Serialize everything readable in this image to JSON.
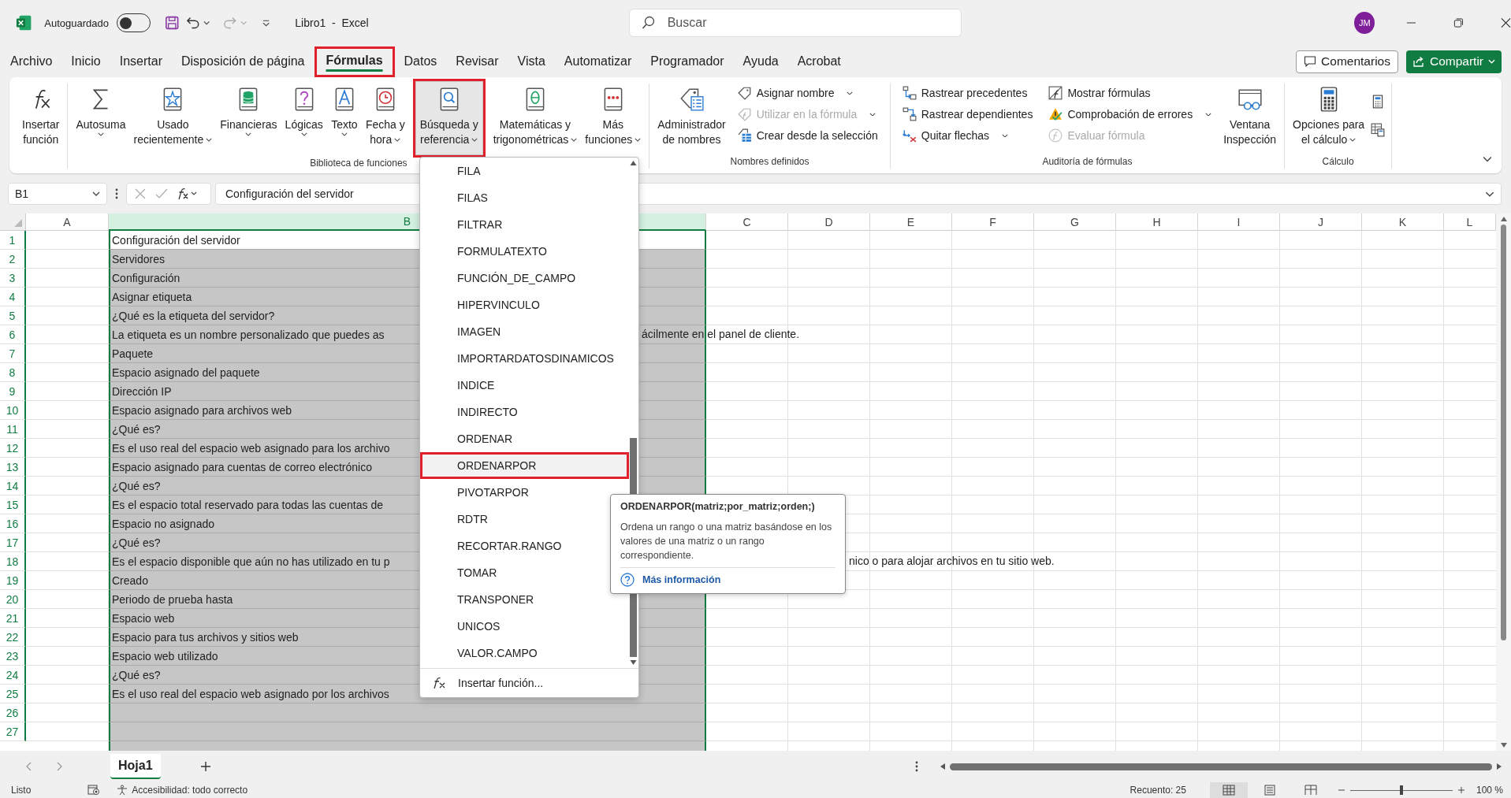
{
  "title_bar": {
    "autosave_label": "Autoguardado",
    "autosave_on": false,
    "title": "Libro1  -  Excel",
    "search_placeholder": "Buscar",
    "avatar": "JM"
  },
  "menu_tabs": [
    {
      "label": "Archivo",
      "selected": false,
      "highlighted": false
    },
    {
      "label": "Inicio",
      "selected": false,
      "highlighted": false
    },
    {
      "label": "Insertar",
      "selected": false,
      "highlighted": false
    },
    {
      "label": "Disposición de página",
      "selected": false,
      "highlighted": false
    },
    {
      "label": "Fórmulas",
      "selected": true,
      "highlighted": true
    },
    {
      "label": "Datos",
      "selected": false,
      "highlighted": false
    },
    {
      "label": "Revisar",
      "selected": false,
      "highlighted": false
    },
    {
      "label": "Vista",
      "selected": false,
      "highlighted": false
    },
    {
      "label": "Automatizar",
      "selected": false,
      "highlighted": false
    },
    {
      "label": "Programador",
      "selected": false,
      "highlighted": false
    },
    {
      "label": "Ayuda",
      "selected": false,
      "highlighted": false
    },
    {
      "label": "Acrobat",
      "selected": false,
      "highlighted": false
    }
  ],
  "comments_button": "Comentarios",
  "share_button": "Compartir",
  "ribbon": {
    "groups": [
      {
        "parts": [
          {
            "kind": "big",
            "lines": [
              "Insertar",
              "función"
            ],
            "dropdown": false,
            "selected": false,
            "highlighted": false
          }
        ]
      },
      {
        "label": "Biblioteca de funciones",
        "parts": [
          {
            "kind": "big",
            "lines": [
              "Autosuma"
            ],
            "dropdown": true,
            "selected": false,
            "highlighted": false
          },
          {
            "kind": "big",
            "lines": [
              "Usado",
              "recientemente"
            ],
            "dropdown": true,
            "selected": false,
            "highlighted": false
          },
          {
            "kind": "big",
            "lines": [
              "Financieras"
            ],
            "dropdown": true,
            "selected": false,
            "highlighted": false
          },
          {
            "kind": "big",
            "lines": [
              "Lógicas"
            ],
            "dropdown": true,
            "selected": false,
            "highlighted": false
          },
          {
            "kind": "big",
            "lines": [
              "Texto"
            ],
            "dropdown": true,
            "selected": false,
            "highlighted": false
          },
          {
            "kind": "big",
            "lines": [
              "Fecha y",
              "hora"
            ],
            "dropdown": true,
            "selected": false,
            "highlighted": false
          },
          {
            "kind": "big",
            "lines": [
              "Búsqueda y",
              "referencia"
            ],
            "dropdown": true,
            "selected": true,
            "highlighted": true
          },
          {
            "kind": "big",
            "lines": [
              "Matemáticas y",
              "trigonométricas"
            ],
            "dropdown": true,
            "selected": false,
            "highlighted": false
          },
          {
            "kind": "big",
            "lines": [
              "Más",
              "funciones"
            ],
            "dropdown": true,
            "selected": false,
            "highlighted": false
          }
        ]
      },
      {
        "label": "Nombres definidos",
        "parts": [
          {
            "kind": "big",
            "lines": [
              "Administrador",
              "de nombres"
            ],
            "dropdown": false,
            "selected": false,
            "highlighted": false
          },
          {
            "kind": "column",
            "items": [
              {
                "label": "Asignar nombre",
                "dropdown": true,
                "disabled": false
              },
              {
                "label": "Utilizar en la fórmula",
                "dropdown": true,
                "disabled": true
              },
              {
                "label": "Crear desde la selección",
                "dropdown": false,
                "disabled": false
              }
            ]
          }
        ]
      },
      {
        "label": "Auditoría de fórmulas",
        "parts": [
          {
            "kind": "column",
            "items": [
              {
                "label": "Rastrear precedentes",
                "dropdown": false,
                "disabled": false
              },
              {
                "label": "Rastrear dependientes",
                "dropdown": false,
                "disabled": false
              },
              {
                "label": "Quitar flechas",
                "dropdown": true,
                "disabled": false
              }
            ]
          },
          {
            "kind": "column",
            "items": [
              {
                "label": "Mostrar fórmulas",
                "dropdown": false,
                "disabled": false
              },
              {
                "label": "Comprobación de errores",
                "dropdown": true,
                "disabled": false
              },
              {
                "label": "Evaluar fórmula",
                "dropdown": false,
                "disabled": true
              }
            ]
          },
          {
            "kind": "big",
            "lines": [
              "Ventana",
              "Inspección"
            ],
            "dropdown": false,
            "selected": false,
            "highlighted": false
          }
        ]
      },
      {
        "label": "Cálculo",
        "parts": [
          {
            "kind": "big",
            "lines": [
              "Opciones para",
              "el cálculo"
            ],
            "dropdown": true,
            "selected": false,
            "highlighted": false
          },
          {
            "kind": "icons"
          }
        ]
      }
    ]
  },
  "formula_bar": {
    "name_box": "B1",
    "formula": "Configuración del servidor"
  },
  "columns": [
    {
      "label": "A",
      "selected": false
    },
    {
      "label": "B",
      "selected": true
    },
    {
      "label": "C",
      "selected": false
    },
    {
      "label": "D",
      "selected": false
    },
    {
      "label": "E",
      "selected": false
    },
    {
      "label": "F",
      "selected": false
    },
    {
      "label": "G",
      "selected": false
    },
    {
      "label": "H",
      "selected": false
    },
    {
      "label": "I",
      "selected": false
    },
    {
      "label": "J",
      "selected": false
    },
    {
      "label": "K",
      "selected": false
    },
    {
      "label": "L",
      "selected": false
    }
  ],
  "rows": [
    {
      "number": "1",
      "selected": true,
      "active": true,
      "text": "Configuración del servidor"
    },
    {
      "number": "2",
      "selected": true,
      "active": false,
      "text": "Servidores"
    },
    {
      "number": "3",
      "selected": true,
      "active": false,
      "text": "Configuración"
    },
    {
      "number": "4",
      "selected": true,
      "active": false,
      "text": "Asignar etiqueta"
    },
    {
      "number": "5",
      "selected": true,
      "active": false,
      "text": "¿Qué es la etiqueta del servidor?"
    },
    {
      "number": "6",
      "selected": true,
      "active": false,
      "text": "La etiqueta es un nombre personalizado que puedes as",
      "tail": "ácilmente en el panel de cliente."
    },
    {
      "number": "7",
      "selected": true,
      "active": false,
      "text": "Paquete"
    },
    {
      "number": "8",
      "selected": true,
      "active": false,
      "text": "Espacio asignado del paquete"
    },
    {
      "number": "9",
      "selected": true,
      "active": false,
      "text": "Dirección IP"
    },
    {
      "number": "10",
      "selected": true,
      "active": false,
      "text": "Espacio asignado para archivos web"
    },
    {
      "number": "11",
      "selected": true,
      "active": false,
      "text": "¿Qué es?"
    },
    {
      "number": "12",
      "selected": true,
      "active": false,
      "text": "Es el uso real del espacio web asignado para los archivo"
    },
    {
      "number": "13",
      "selected": true,
      "active": false,
      "text": "Espacio asignado para cuentas de correo electrónico"
    },
    {
      "number": "14",
      "selected": true,
      "active": false,
      "text": "¿Qué es?"
    },
    {
      "number": "15",
      "selected": true,
      "active": false,
      "text": "Es el espacio total reservado para todas las cuentas de"
    },
    {
      "number": "16",
      "selected": true,
      "active": false,
      "text": "Espacio no asignado"
    },
    {
      "number": "17",
      "selected": true,
      "active": false,
      "text": "¿Qué es?"
    },
    {
      "number": "18",
      "selected": true,
      "active": false,
      "text": "Es el espacio disponible que aún no has utilizado en tu p",
      "tail": "nico o para alojar archivos en tu sitio web."
    },
    {
      "number": "19",
      "selected": true,
      "active": false,
      "text": "Creado"
    },
    {
      "number": "20",
      "selected": true,
      "active": false,
      "text": "Periodo de prueba hasta"
    },
    {
      "number": "21",
      "selected": true,
      "active": false,
      "text": "Espacio web"
    },
    {
      "number": "22",
      "selected": true,
      "active": false,
      "text": "Espacio para tus archivos y sitios web"
    },
    {
      "number": "23",
      "selected": true,
      "active": false,
      "text": "Espacio web utilizado"
    },
    {
      "number": "24",
      "selected": true,
      "active": false,
      "text": "¿Qué es?"
    },
    {
      "number": "25",
      "selected": true,
      "active": false,
      "text": "Es el uso real del espacio web asignado por los archivos"
    },
    {
      "number": "26",
      "selected": true,
      "active": false
    },
    {
      "number": "27",
      "selected": true,
      "active": false
    }
  ],
  "function_menu": {
    "items": [
      {
        "label": "FILA",
        "hovered": false,
        "highlighted": false
      },
      {
        "label": "FILAS",
        "hovered": false,
        "highlighted": false
      },
      {
        "label": "FILTRAR",
        "hovered": false,
        "highlighted": false
      },
      {
        "label": "FORMULATEXTO",
        "hovered": false,
        "highlighted": false
      },
      {
        "label": "FUNCIÓN_DE_CAMPO",
        "hovered": false,
        "highlighted": false
      },
      {
        "label": "HIPERVINCULO",
        "hovered": false,
        "highlighted": false
      },
      {
        "label": "IMAGEN",
        "hovered": false,
        "highlighted": false
      },
      {
        "label": "IMPORTARDATOSDINAMICOS",
        "hovered": false,
        "highlighted": false
      },
      {
        "label": "INDICE",
        "hovered": false,
        "highlighted": false
      },
      {
        "label": "INDIRECTO",
        "hovered": false,
        "highlighted": false
      },
      {
        "label": "ORDENAR",
        "hovered": false,
        "highlighted": false
      },
      {
        "label": "ORDENARPOR",
        "hovered": true,
        "highlighted": true
      },
      {
        "label": "PIVOTARPOR",
        "hovered": false,
        "highlighted": false
      },
      {
        "label": "RDTR",
        "hovered": false,
        "highlighted": false
      },
      {
        "label": "RECORTAR.RANGO",
        "hovered": false,
        "highlighted": false
      },
      {
        "label": "TOMAR",
        "hovered": false,
        "highlighted": false
      },
      {
        "label": "TRANSPONER",
        "hovered": false,
        "highlighted": false
      },
      {
        "label": "UNICOS",
        "hovered": false,
        "highlighted": false
      },
      {
        "label": "VALOR.CAMPO",
        "hovered": false,
        "highlighted": false
      }
    ],
    "footer": "Insertar función..."
  },
  "tooltip": {
    "signature": "ORDENARPOR(matriz;por_matriz;orden;)",
    "description": "Ordena un rango o una matriz basándose en los valores de una matriz o un rango correspondiente.",
    "link": "Más información"
  },
  "sheet_tabs": [
    {
      "label": "Hoja1",
      "selected": true
    }
  ],
  "status_bar": {
    "status": "Listo",
    "accessibility": "Accesibilidad: todo correcto",
    "count": "Recuento: 25",
    "views": [
      {
        "kind": "normal",
        "selected": true
      },
      {
        "kind": "page-layout",
        "selected": false
      },
      {
        "kind": "page-break",
        "selected": false
      }
    ],
    "zoom_slider": {
      "level": 0.5
    },
    "zoom": "100 %"
  }
}
